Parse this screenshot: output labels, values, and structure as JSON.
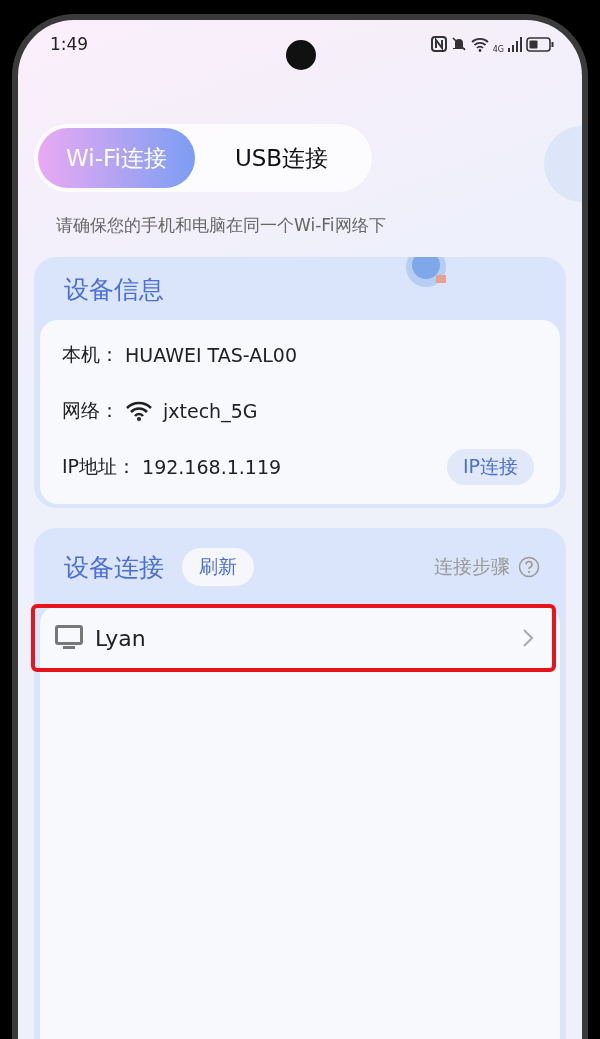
{
  "status_bar": {
    "time": "1:49",
    "network_type": "4G"
  },
  "tabs": [
    {
      "label": "Wi-Fi连接",
      "selected": true
    },
    {
      "label": "USB连接",
      "selected": false
    }
  ],
  "hint": "请确保您的手机和电脑在同一个Wi-Fi网络下",
  "device_info": {
    "title": "设备信息",
    "rows": [
      {
        "kind": "text",
        "label": "本机：",
        "value": "HUAWEI TAS-AL00"
      },
      {
        "kind": "wifi",
        "label": "网络：",
        "value": "jxtech_5G"
      },
      {
        "kind": "text",
        "label": "IP地址：",
        "value": "192.168.1.119"
      }
    ],
    "ip_button": "IP连接"
  },
  "device_connect": {
    "title": "设备连接",
    "refresh": "刷新",
    "steps": "连接步骤",
    "devices": [
      {
        "name": "Lyan",
        "highlighted": true
      }
    ]
  }
}
